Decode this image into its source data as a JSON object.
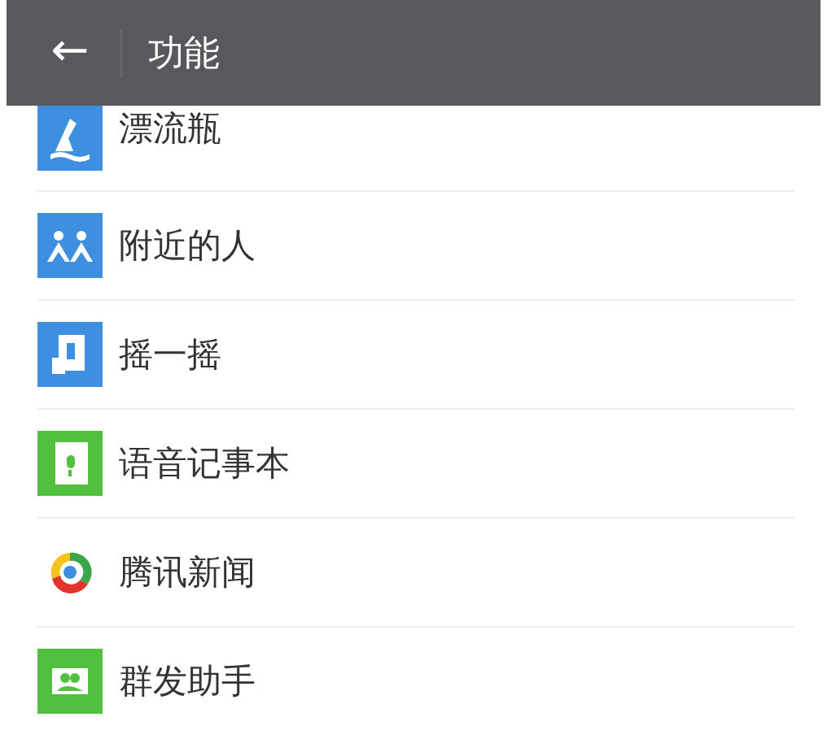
{
  "header": {
    "back": "←",
    "title": "功能"
  },
  "items": [
    {
      "kind": "bottle",
      "label": "漂流瓶"
    },
    {
      "kind": "people",
      "label": "附近的人"
    },
    {
      "kind": "shake",
      "label": "摇一摇"
    },
    {
      "kind": "voice",
      "label": "语音记事本"
    },
    {
      "kind": "news",
      "label": "腾讯新闻"
    },
    {
      "kind": "broadcast",
      "label": "群发助手"
    }
  ]
}
